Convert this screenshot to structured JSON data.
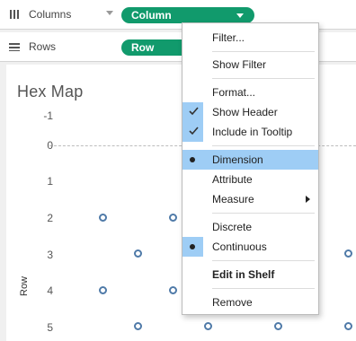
{
  "shelves": {
    "columns": {
      "label": "Columns",
      "pill": "Column"
    },
    "rows": {
      "label": "Rows",
      "pill": "Row"
    }
  },
  "view": {
    "title": "Hex Map",
    "y_axis_title": "Row",
    "y_ticks": [
      "-1",
      "0",
      "1",
      "2",
      "3",
      "4",
      "5"
    ]
  },
  "context_menu": {
    "items": {
      "filter": "Filter...",
      "show_filter": "Show Filter",
      "format": "Format...",
      "show_header": "Show Header",
      "include_tooltip": "Include in Tooltip",
      "dimension": "Dimension",
      "attribute": "Attribute",
      "measure": "Measure",
      "discrete": "Discrete",
      "continuous": "Continuous",
      "edit_in_shelf": "Edit in Shelf",
      "remove": "Remove"
    }
  },
  "colors": {
    "pill": "#119a6c",
    "marker_stroke": "#4f7aa8",
    "menu_selection": "#9ecdf5"
  }
}
